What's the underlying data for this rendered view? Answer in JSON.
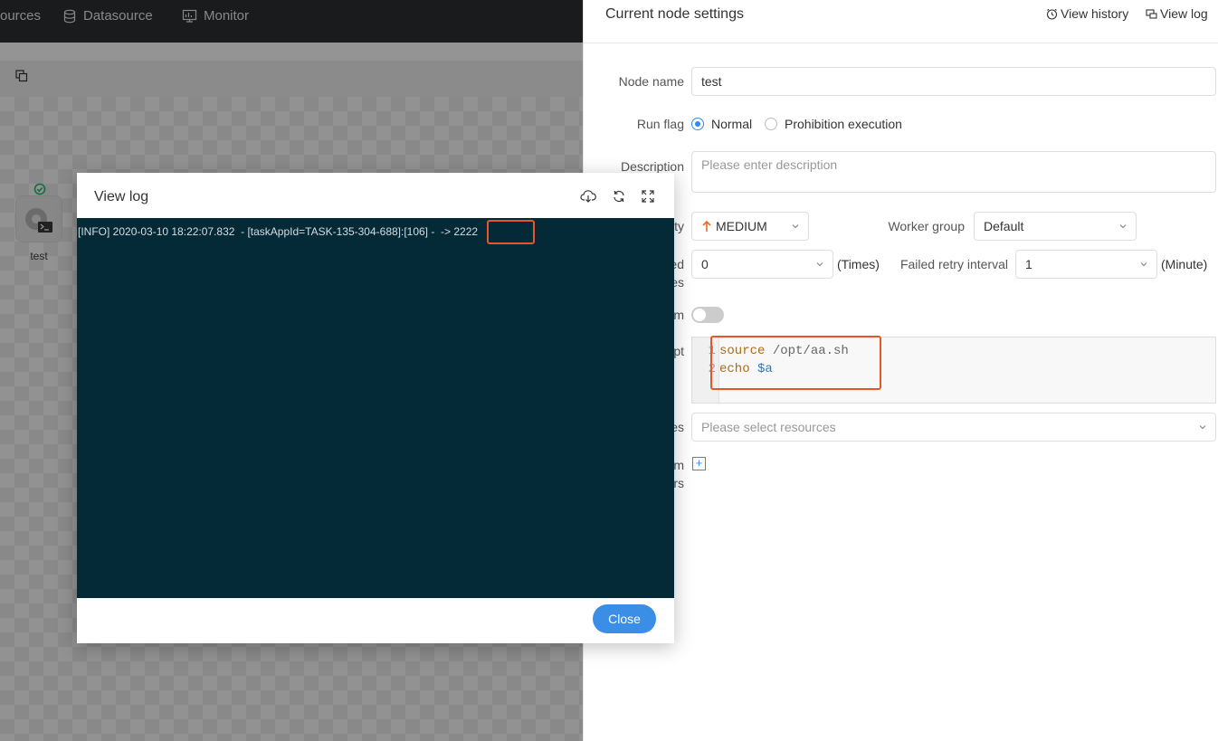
{
  "topnav": {
    "items": [
      {
        "label": "ources",
        "icon": "resources-icon"
      },
      {
        "label": "Datasource",
        "icon": "database-icon"
      },
      {
        "label": "Monitor",
        "icon": "monitor-icon"
      }
    ]
  },
  "canvas": {
    "node_label": "test"
  },
  "drawer": {
    "title": "Current node settings",
    "view_history": "View history",
    "view_log": "View log",
    "node_name_label": "Node name",
    "node_name_value": "test",
    "run_flag_label": "Run flag",
    "run_flag_options": [
      "Normal",
      "Prohibition execution"
    ],
    "run_flag_selected": "Normal",
    "description_label": "Description",
    "description_placeholder": "Please enter description",
    "priority_label_partial": "ity",
    "priority_value": "MEDIUM",
    "worker_group_label": "Worker group",
    "worker_group_value": "Default",
    "retry_label_partial_1": "ed",
    "retry_label_partial_2": "es",
    "retry_times_value": "0",
    "retry_times_unit": "(Times)",
    "retry_interval_label": "Failed retry interval",
    "retry_interval_value": "1",
    "retry_interval_unit": "(Minute)",
    "timeout_label_partial": "m",
    "script_label_partial": "pt",
    "script_lines": [
      {
        "n": "1",
        "kw": "source",
        "rest": " /opt/aa.sh"
      },
      {
        "n": "2",
        "kw": "echo",
        "rest": " $a"
      }
    ],
    "resources_label_partial": "es",
    "resources_placeholder": "Please select resources",
    "custom_params_label_partial_1": "m",
    "custom_params_label_partial_2": "rs"
  },
  "modal": {
    "title": "View log",
    "log_text": "[INFO] 2020-03-10 18:22:07.832  - [taskAppId=TASK-135-304-688]:[106] -  -> 2222",
    "close_label": "Close"
  },
  "colors": {
    "accent": "#2d8cf0",
    "log_bg": "#042a38",
    "highlight": "#e8552a",
    "priority_arrow": "#f06a1f"
  }
}
